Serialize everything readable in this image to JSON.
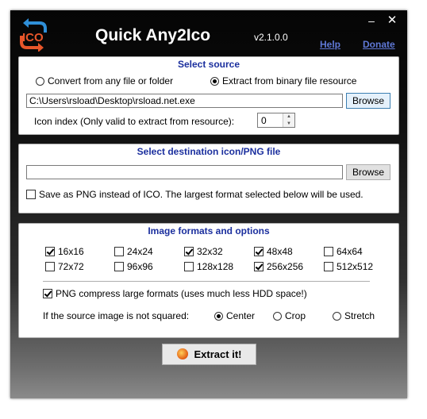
{
  "window": {
    "title": "Quick Any2Ico",
    "version": "v2.1.0.0",
    "help_link": "Help",
    "donate_link": "Donate",
    "minimize": "–",
    "close": "✕",
    "logo_text": "ICO"
  },
  "source": {
    "title": "Select source",
    "option_file": "Convert from any file or folder",
    "option_binary": "Extract from binary file resource",
    "selected": "binary",
    "path": "C:\\Users\\rsload\\Desktop\\rsload.net.exe",
    "browse": "Browse",
    "icon_index_label": "Icon index (Only valid to extract from resource):",
    "icon_index_value": "0"
  },
  "destination": {
    "title": "Select destination icon/PNG file",
    "path": "",
    "browse": "Browse",
    "save_png_label": "Save as PNG instead of ICO. The largest format selected below will be used.",
    "save_png_checked": false
  },
  "formats": {
    "title": "Image formats and options",
    "sizes": [
      {
        "label": "16x16",
        "checked": true
      },
      {
        "label": "24x24",
        "checked": false
      },
      {
        "label": "32x32",
        "checked": true
      },
      {
        "label": "48x48",
        "checked": true
      },
      {
        "label": "64x64",
        "checked": false
      },
      {
        "label": "72x72",
        "checked": false
      },
      {
        "label": "96x96",
        "checked": false
      },
      {
        "label": "128x128",
        "checked": false
      },
      {
        "label": "256x256",
        "checked": true
      },
      {
        "label": "512x512",
        "checked": false
      }
    ],
    "png_compress_label": "PNG compress large formats (uses much less HDD space!)",
    "png_compress_checked": true,
    "not_squared_label": "If the source image is not squared:",
    "align_options": [
      "Center",
      "Crop",
      "Stretch"
    ],
    "align_selected": "Center"
  },
  "action": {
    "extract": "Extract it!"
  }
}
